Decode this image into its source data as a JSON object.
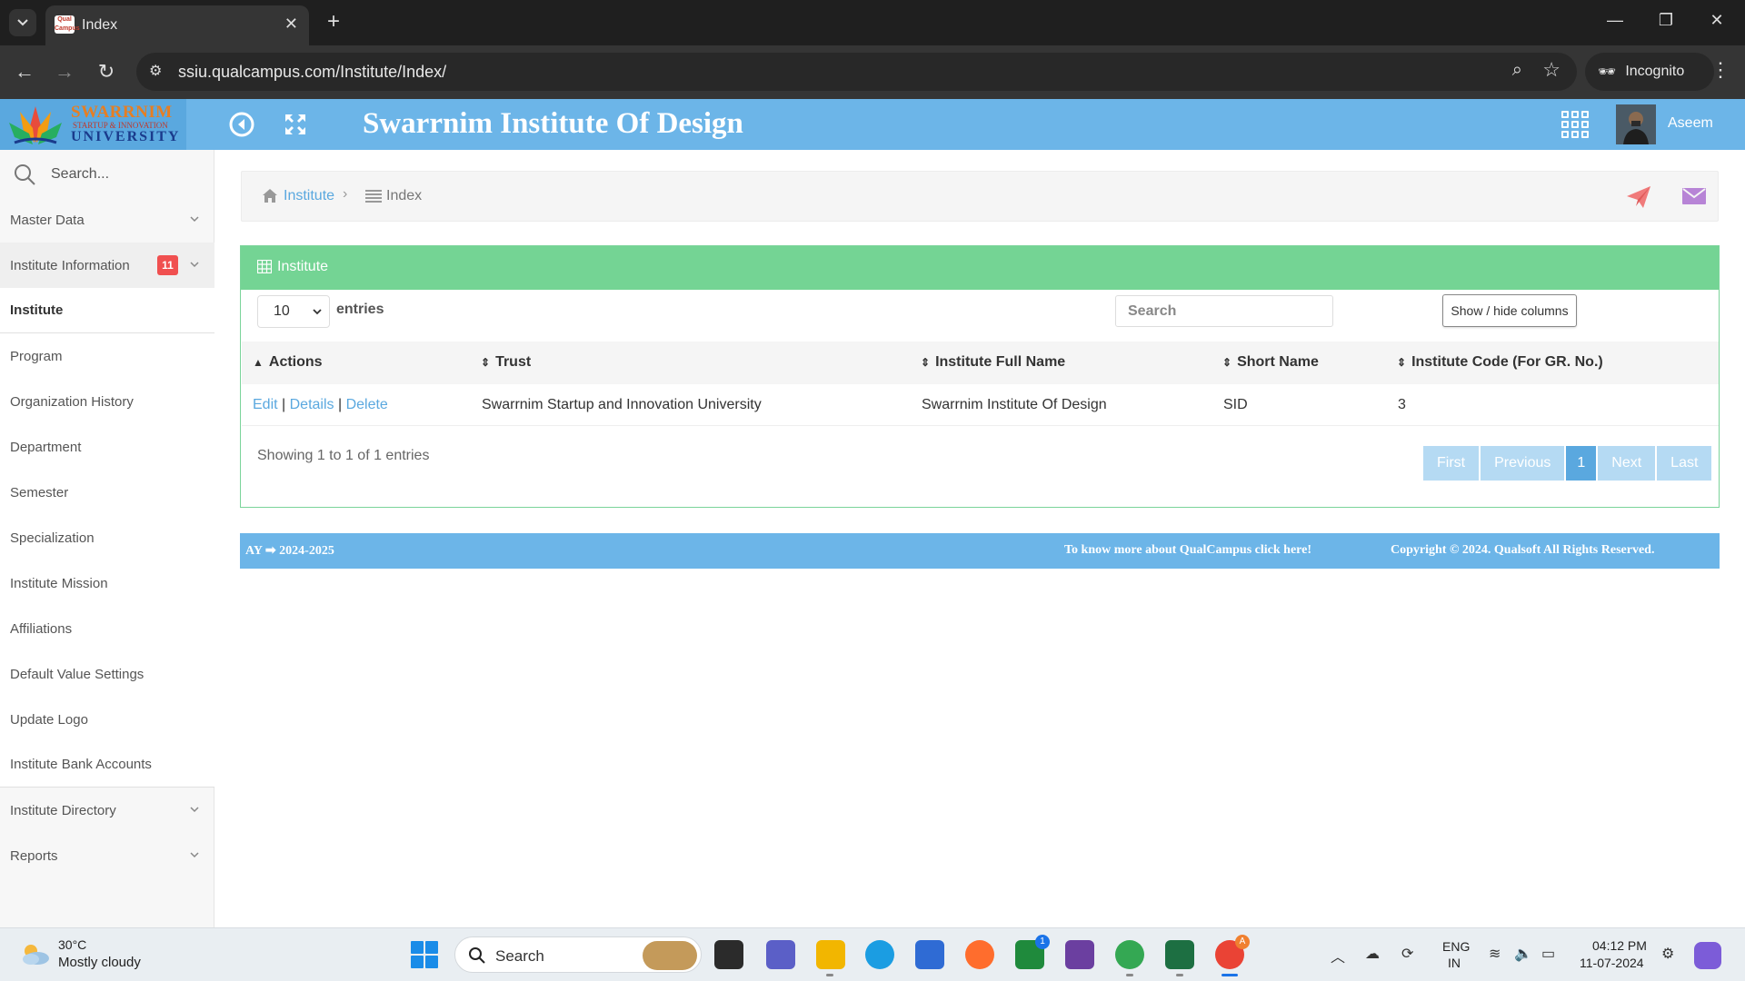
{
  "browser": {
    "tab_title": "Index",
    "tab_favicon_text": "Qual Campus",
    "url": "ssiu.qualcampus.com/Institute/Index/",
    "incognito_label": "Incognito"
  },
  "header": {
    "logo_line1": "SWARRNIM",
    "logo_line2": "STARTUP & INNOVATION",
    "logo_line3": "UNIVERSITY",
    "title": "Swarrnim Institute Of Design",
    "user_name": "Aseem"
  },
  "sidebar": {
    "search_placeholder": "Search...",
    "items": [
      {
        "label": "Master Data"
      },
      {
        "label": "Institute Information",
        "badge": "11"
      },
      {
        "label": "Institute"
      },
      {
        "label": "Program"
      },
      {
        "label": "Organization History"
      },
      {
        "label": "Department"
      },
      {
        "label": "Semester"
      },
      {
        "label": "Specialization"
      },
      {
        "label": "Institute Mission"
      },
      {
        "label": "Affiliations"
      },
      {
        "label": "Default Value Settings"
      },
      {
        "label": "Update Logo"
      },
      {
        "label": "Institute Bank Accounts"
      },
      {
        "label": "Institute Directory"
      },
      {
        "label": "Reports"
      }
    ]
  },
  "breadcrumb": {
    "root": "Institute",
    "current": "Index"
  },
  "panel": {
    "title": "Institute",
    "page_length": "10",
    "entries_label": "entries",
    "search_placeholder": "Search",
    "columns_button": "Show / hide columns",
    "columns": [
      "Actions",
      "Trust",
      "Institute Full Name",
      "Short Name",
      "Institute Code (For GR. No.)"
    ],
    "rows": [
      {
        "actions": {
          "edit": "Edit",
          "sep1": " | ",
          "details": "Details",
          "sep2": " | ",
          "delete": "Delete"
        },
        "trust": "Swarrnim Startup and Innovation University",
        "full_name": "Swarrnim Institute Of Design",
        "short_name": "SID",
        "code": "3"
      }
    ],
    "info": "Showing 1 to 1 of 1 entries",
    "pager": [
      "First",
      "Previous",
      "1",
      "Next",
      "Last"
    ]
  },
  "footer": {
    "ay_label": "AY",
    "ay_value": "2024-2025",
    "link_text": "To know more about QualCampus click here!",
    "copyright": "Copyright © 2024. Qualsoft All Rights Reserved."
  },
  "taskbar": {
    "weather_temp": "30°C",
    "weather_desc": "Mostly cloudy",
    "search_label": "Search",
    "lang1": "ENG",
    "lang2": "IN",
    "time": "04:12 PM",
    "date": "11-07-2024",
    "teams_badge": "1",
    "chrome_badge": "A"
  },
  "colors": {
    "header_blue": "#6cb5e8",
    "panel_green": "#74d494",
    "link_blue": "#5aa8df",
    "badge_red": "#f05050"
  }
}
